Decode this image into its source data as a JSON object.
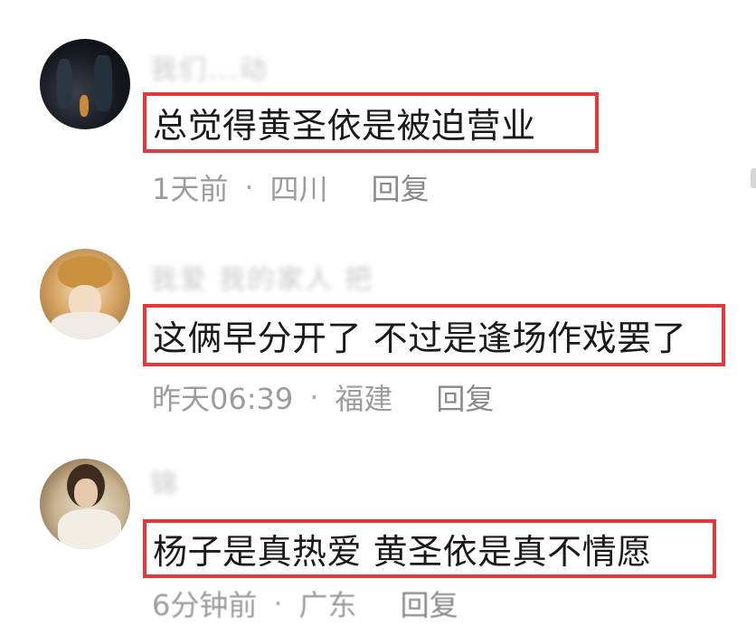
{
  "comments": [
    {
      "username": "我们...动",
      "text": "总觉得黄圣依是被迫营业",
      "time": "1天前",
      "location": "四川",
      "reply_label": "回复"
    },
    {
      "username": "我爱 我的家人 把",
      "text": "这俩早分开了 不过是逢场作戏罢了",
      "time": "昨天06:39",
      "location": "福建",
      "reply_label": "回复"
    },
    {
      "username": "锦",
      "text": "杨子是真热爱  黄圣依是真不情愿",
      "time": "6分钟前",
      "location": "广东",
      "reply_label": "回复"
    }
  ],
  "separator": "·",
  "colors": {
    "highlight_border": "#e5383b",
    "text": "#1a1a1a",
    "meta": "#9c9c9c"
  }
}
